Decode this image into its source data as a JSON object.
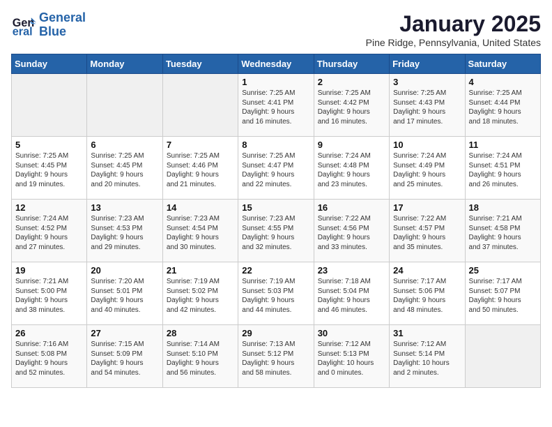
{
  "logo": {
    "line1": "General",
    "line2": "Blue"
  },
  "title": "January 2025",
  "subtitle": "Pine Ridge, Pennsylvania, United States",
  "headers": [
    "Sunday",
    "Monday",
    "Tuesday",
    "Wednesday",
    "Thursday",
    "Friday",
    "Saturday"
  ],
  "weeks": [
    [
      {
        "day": "",
        "info": ""
      },
      {
        "day": "",
        "info": ""
      },
      {
        "day": "",
        "info": ""
      },
      {
        "day": "1",
        "info": "Sunrise: 7:25 AM\nSunset: 4:41 PM\nDaylight: 9 hours\nand 16 minutes."
      },
      {
        "day": "2",
        "info": "Sunrise: 7:25 AM\nSunset: 4:42 PM\nDaylight: 9 hours\nand 16 minutes."
      },
      {
        "day": "3",
        "info": "Sunrise: 7:25 AM\nSunset: 4:43 PM\nDaylight: 9 hours\nand 17 minutes."
      },
      {
        "day": "4",
        "info": "Sunrise: 7:25 AM\nSunset: 4:44 PM\nDaylight: 9 hours\nand 18 minutes."
      }
    ],
    [
      {
        "day": "5",
        "info": "Sunrise: 7:25 AM\nSunset: 4:45 PM\nDaylight: 9 hours\nand 19 minutes."
      },
      {
        "day": "6",
        "info": "Sunrise: 7:25 AM\nSunset: 4:45 PM\nDaylight: 9 hours\nand 20 minutes."
      },
      {
        "day": "7",
        "info": "Sunrise: 7:25 AM\nSunset: 4:46 PM\nDaylight: 9 hours\nand 21 minutes."
      },
      {
        "day": "8",
        "info": "Sunrise: 7:25 AM\nSunset: 4:47 PM\nDaylight: 9 hours\nand 22 minutes."
      },
      {
        "day": "9",
        "info": "Sunrise: 7:24 AM\nSunset: 4:48 PM\nDaylight: 9 hours\nand 23 minutes."
      },
      {
        "day": "10",
        "info": "Sunrise: 7:24 AM\nSunset: 4:49 PM\nDaylight: 9 hours\nand 25 minutes."
      },
      {
        "day": "11",
        "info": "Sunrise: 7:24 AM\nSunset: 4:51 PM\nDaylight: 9 hours\nand 26 minutes."
      }
    ],
    [
      {
        "day": "12",
        "info": "Sunrise: 7:24 AM\nSunset: 4:52 PM\nDaylight: 9 hours\nand 27 minutes."
      },
      {
        "day": "13",
        "info": "Sunrise: 7:23 AM\nSunset: 4:53 PM\nDaylight: 9 hours\nand 29 minutes."
      },
      {
        "day": "14",
        "info": "Sunrise: 7:23 AM\nSunset: 4:54 PM\nDaylight: 9 hours\nand 30 minutes."
      },
      {
        "day": "15",
        "info": "Sunrise: 7:23 AM\nSunset: 4:55 PM\nDaylight: 9 hours\nand 32 minutes."
      },
      {
        "day": "16",
        "info": "Sunrise: 7:22 AM\nSunset: 4:56 PM\nDaylight: 9 hours\nand 33 minutes."
      },
      {
        "day": "17",
        "info": "Sunrise: 7:22 AM\nSunset: 4:57 PM\nDaylight: 9 hours\nand 35 minutes."
      },
      {
        "day": "18",
        "info": "Sunrise: 7:21 AM\nSunset: 4:58 PM\nDaylight: 9 hours\nand 37 minutes."
      }
    ],
    [
      {
        "day": "19",
        "info": "Sunrise: 7:21 AM\nSunset: 5:00 PM\nDaylight: 9 hours\nand 38 minutes."
      },
      {
        "day": "20",
        "info": "Sunrise: 7:20 AM\nSunset: 5:01 PM\nDaylight: 9 hours\nand 40 minutes."
      },
      {
        "day": "21",
        "info": "Sunrise: 7:19 AM\nSunset: 5:02 PM\nDaylight: 9 hours\nand 42 minutes."
      },
      {
        "day": "22",
        "info": "Sunrise: 7:19 AM\nSunset: 5:03 PM\nDaylight: 9 hours\nand 44 minutes."
      },
      {
        "day": "23",
        "info": "Sunrise: 7:18 AM\nSunset: 5:04 PM\nDaylight: 9 hours\nand 46 minutes."
      },
      {
        "day": "24",
        "info": "Sunrise: 7:17 AM\nSunset: 5:06 PM\nDaylight: 9 hours\nand 48 minutes."
      },
      {
        "day": "25",
        "info": "Sunrise: 7:17 AM\nSunset: 5:07 PM\nDaylight: 9 hours\nand 50 minutes."
      }
    ],
    [
      {
        "day": "26",
        "info": "Sunrise: 7:16 AM\nSunset: 5:08 PM\nDaylight: 9 hours\nand 52 minutes."
      },
      {
        "day": "27",
        "info": "Sunrise: 7:15 AM\nSunset: 5:09 PM\nDaylight: 9 hours\nand 54 minutes."
      },
      {
        "day": "28",
        "info": "Sunrise: 7:14 AM\nSunset: 5:10 PM\nDaylight: 9 hours\nand 56 minutes."
      },
      {
        "day": "29",
        "info": "Sunrise: 7:13 AM\nSunset: 5:12 PM\nDaylight: 9 hours\nand 58 minutes."
      },
      {
        "day": "30",
        "info": "Sunrise: 7:12 AM\nSunset: 5:13 PM\nDaylight: 10 hours\nand 0 minutes."
      },
      {
        "day": "31",
        "info": "Sunrise: 7:12 AM\nSunset: 5:14 PM\nDaylight: 10 hours\nand 2 minutes."
      },
      {
        "day": "",
        "info": ""
      }
    ]
  ]
}
